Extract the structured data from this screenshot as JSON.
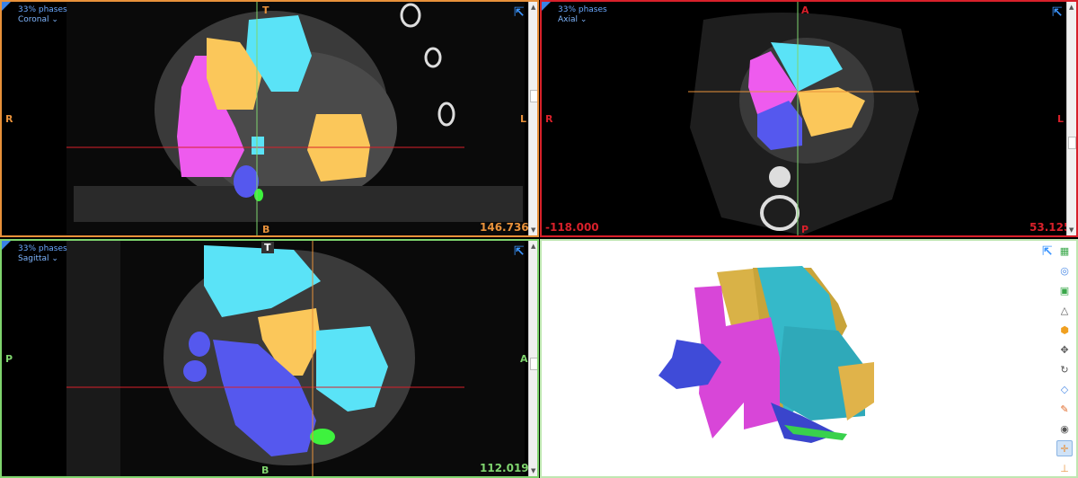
{
  "coronal": {
    "phase": "33% phases",
    "view": "Coronal ⌄",
    "top": "T",
    "bottom": "B",
    "left": "R",
    "right": "L",
    "value": "146.7365"
  },
  "axial": {
    "phase": "33% phases",
    "view": "Axial ⌄",
    "top": "A",
    "bottom": "P",
    "left": "R",
    "right": "L",
    "left_value": "-118.000",
    "value": "53.125"
  },
  "sagittal": {
    "phase": "33% phases",
    "view": "Sagittal ⌄",
    "top": "T",
    "bottom": "B",
    "left": "P",
    "right": "A",
    "value": "112.0196"
  },
  "colors": {
    "coronal": "#e8913a",
    "axial": "#d8202a",
    "sagittal": "#7fd46e",
    "accent": "#3a94ff"
  },
  "toolbar_icons": [
    "grid-icon",
    "overlay-icon",
    "fill-icon",
    "triangle-icon",
    "cube-color-icon",
    "move-icon",
    "rotate-icon",
    "cube-icon",
    "paint-icon",
    "eye-icon",
    "crosshair-icon",
    "measure-icon",
    "contrast-icon"
  ]
}
